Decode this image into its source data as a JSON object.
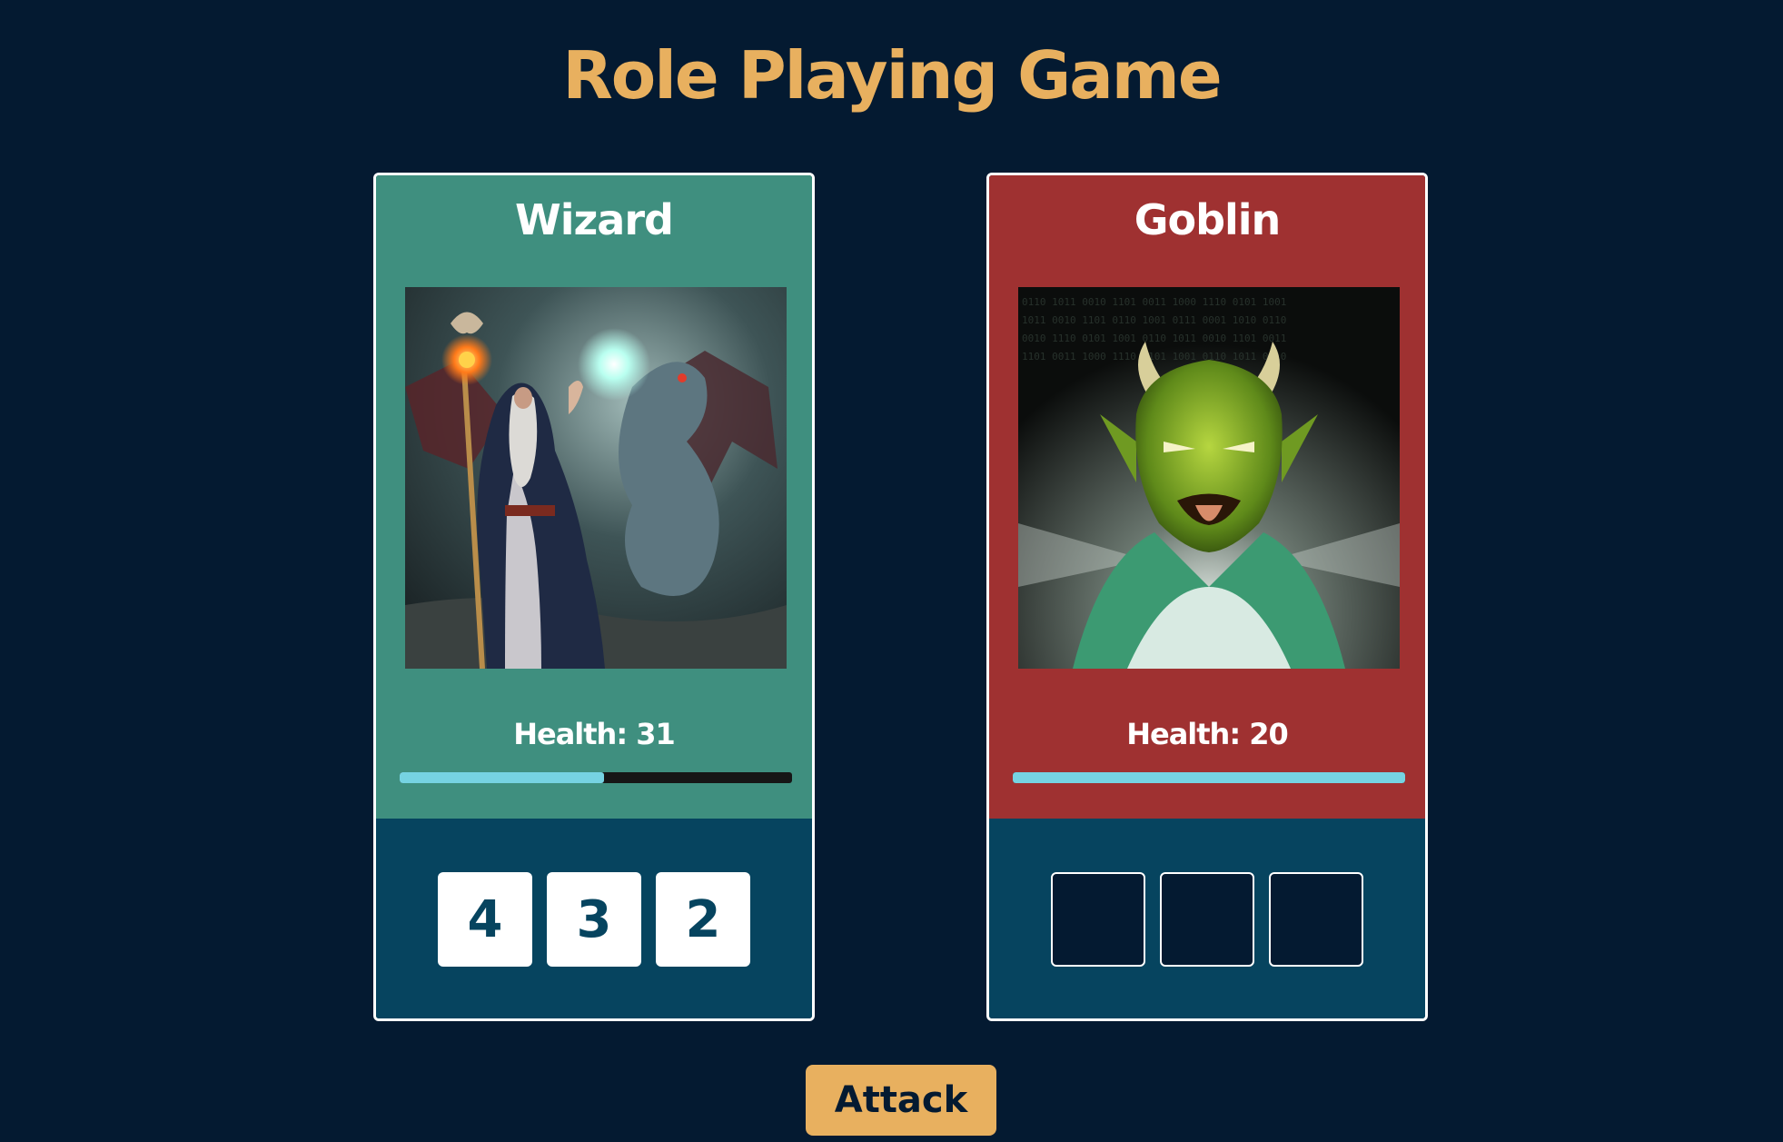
{
  "page_title": "Role Playing Game",
  "hero": {
    "name": "Wizard",
    "health_label": "Health: 31",
    "health_fraction": 0.52,
    "dice": [
      "4",
      "3",
      "2"
    ],
    "portrait_icon": "wizard-with-dragon-portrait"
  },
  "monster": {
    "name": "Goblin",
    "health_label": "Health: 20",
    "health_fraction": 1.0,
    "dice": [
      "",
      "",
      ""
    ],
    "portrait_icon": "green-goblin-portrait"
  },
  "controls": {
    "attack_label": "Attack"
  },
  "colors": {
    "background": "#041a31",
    "accent": "#e8b05f",
    "hero_card": "#3f8f7f",
    "monster_card": "#9f3131",
    "dice_area": "#06445f",
    "health_fill": "#76d3e2"
  }
}
